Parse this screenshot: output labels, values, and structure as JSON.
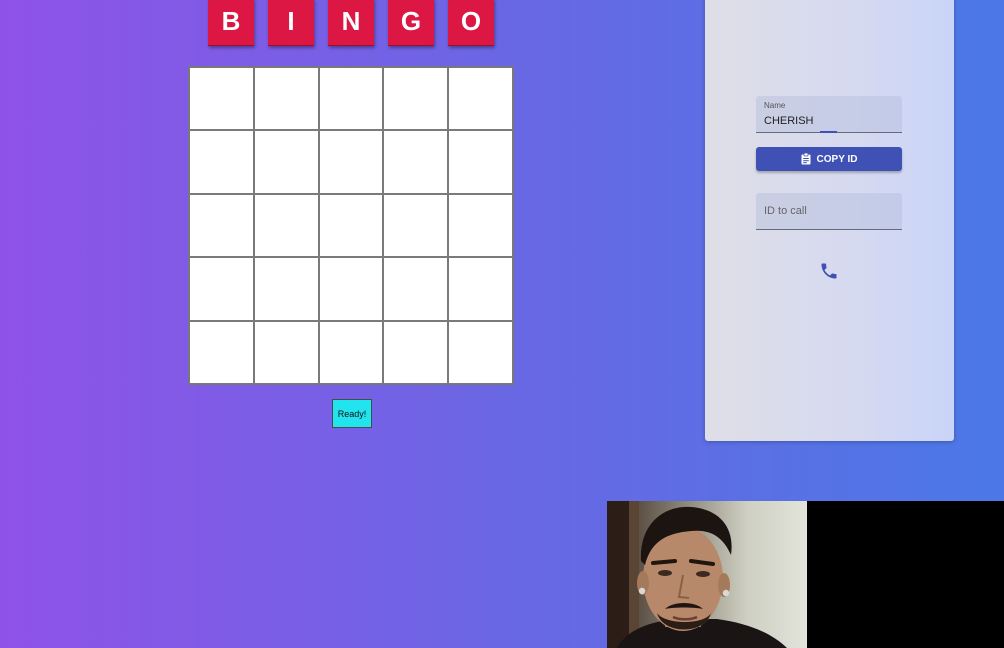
{
  "bingo": {
    "letters": [
      "B",
      "I",
      "N",
      "G",
      "O"
    ],
    "ready_label": "Ready!"
  },
  "panel": {
    "name_label": "Name",
    "name_value": "CHERISH",
    "copy_id_label": "COPY ID",
    "call_placeholder": "ID to call"
  },
  "icons": {
    "copy": "clipboard-icon",
    "call": "phone-icon"
  },
  "colors": {
    "letter_tile": "#dc1743",
    "ready_button": "#22e4ef",
    "primary": "#3f51b5"
  }
}
